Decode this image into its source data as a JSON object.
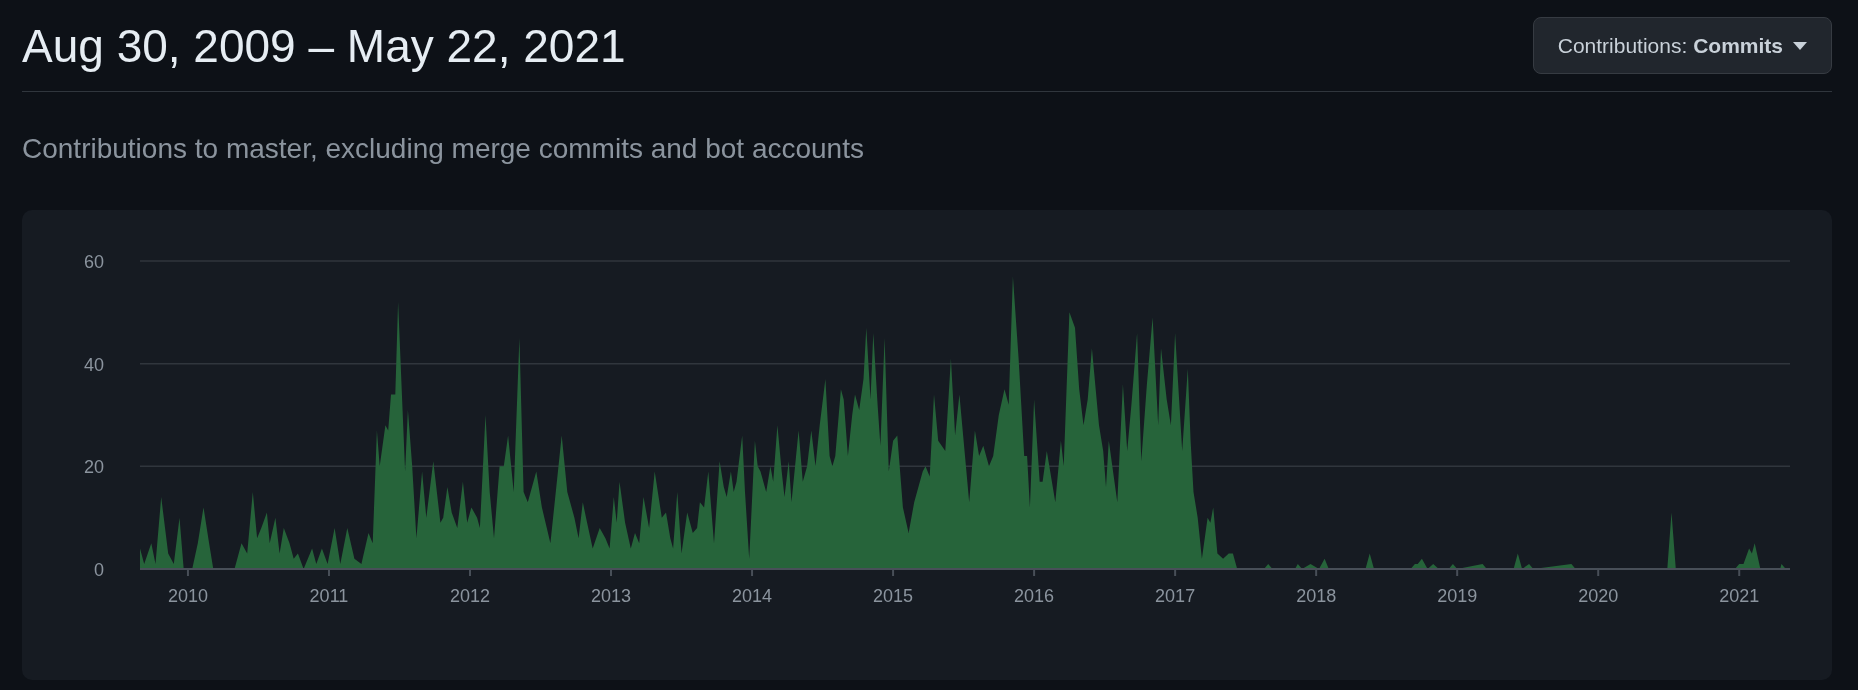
{
  "header": {
    "title": "Aug 30, 2009 – May 22, 2021",
    "menu_button": {
      "label": "Contributions: **Commits**"
    }
  },
  "subtitle": "Contributions to master, excluding merge commits and bot accounts",
  "chart": {
    "chart_data": {
      "type": "area",
      "xlim": [
        2009.66,
        2021.36
      ],
      "ylim": [
        0,
        60
      ],
      "yticks": [
        0,
        20,
        40,
        60
      ],
      "xticks": [
        2010,
        2011,
        2012,
        2013,
        2014,
        2015,
        2016,
        2017,
        2018,
        2019,
        2020,
        2021
      ],
      "x": [
        2009.66,
        2009.69,
        2009.74,
        2009.77,
        2009.81,
        2009.86,
        2009.9,
        2009.94,
        2009.97,
        2010.03,
        2010.07,
        2010.11,
        2010.15,
        2010.18,
        2010.33,
        2010.38,
        2010.42,
        2010.46,
        2010.49,
        2010.52,
        2010.56,
        2010.58,
        2010.62,
        2010.65,
        2010.68,
        2010.72,
        2010.75,
        2010.78,
        2010.82,
        2010.88,
        2010.91,
        2010.95,
        2010.99,
        2011.04,
        2011.08,
        2011.13,
        2011.18,
        2011.23,
        2011.28,
        2011.31,
        2011.34,
        2011.36,
        2011.4,
        2011.42,
        2011.44,
        2011.47,
        2011.49,
        2011.54,
        2011.56,
        2011.59,
        2011.62,
        2011.66,
        2011.69,
        2011.74,
        2011.79,
        2011.81,
        2011.84,
        2011.87,
        2011.91,
        2011.95,
        2011.98,
        2012.01,
        2012.05,
        2012.07,
        2012.11,
        2012.14,
        2012.17,
        2012.21,
        2012.24,
        2012.27,
        2012.31,
        2012.35,
        2012.38,
        2012.41,
        2012.47,
        2012.51,
        2012.57,
        2012.65,
        2012.69,
        2012.74,
        2012.77,
        2012.8,
        2012.83,
        2012.87,
        2012.92,
        2012.96,
        2012.99,
        2013.02,
        2013.04,
        2013.06,
        2013.1,
        2013.14,
        2013.17,
        2013.2,
        2013.23,
        2013.27,
        2013.31,
        2013.36,
        2013.39,
        2013.42,
        2013.44,
        2013.47,
        2013.5,
        2013.54,
        2013.58,
        2013.61,
        2013.63,
        2013.66,
        2013.69,
        2013.73,
        2013.77,
        2013.8,
        2013.82,
        2013.85,
        2013.87,
        2013.89,
        2013.93,
        2013.95,
        2013.98,
        2014.02,
        2014.04,
        2014.06,
        2014.1,
        2014.13,
        2014.15,
        2014.18,
        2014.21,
        2014.23,
        2014.26,
        2014.28,
        2014.33,
        2014.36,
        2014.39,
        2014.42,
        2014.45,
        2014.48,
        2014.52,
        2014.55,
        2014.57,
        2014.59,
        2014.63,
        2014.65,
        2014.68,
        2014.71,
        2014.73,
        2014.76,
        2014.79,
        2014.81,
        2014.84,
        2014.86,
        2014.89,
        2014.91,
        2014.94,
        2014.97,
        2015.0,
        2015.03,
        2015.07,
        2015.11,
        2015.15,
        2015.21,
        2015.23,
        2015.26,
        2015.29,
        2015.32,
        2015.37,
        2015.41,
        2015.44,
        2015.47,
        2015.51,
        2015.54,
        2015.58,
        2015.61,
        2015.64,
        2015.68,
        2015.71,
        2015.75,
        2015.79,
        2015.82,
        2015.85,
        2015.89,
        2015.93,
        2015.95,
        2015.97,
        2016.0,
        2016.04,
        2016.06,
        2016.09,
        2016.15,
        2016.19,
        2016.21,
        2016.25,
        2016.29,
        2016.32,
        2016.35,
        2016.38,
        2016.41,
        2016.46,
        2016.49,
        2016.51,
        2016.53,
        2016.59,
        2016.63,
        2016.66,
        2016.69,
        2016.73,
        2016.76,
        2016.8,
        2016.84,
        2016.88,
        2016.9,
        2016.94,
        2016.97,
        2017.0,
        2017.05,
        2017.09,
        2017.11,
        2017.13,
        2017.16,
        2017.19,
        2017.23,
        2017.25,
        2017.27,
        2017.3,
        2017.34,
        2017.38,
        2017.41,
        2017.44,
        2017.63,
        2017.66,
        2017.69,
        2017.85,
        2017.87,
        2017.9,
        2017.96,
        2018.02,
        2018.06,
        2018.09,
        2018.35,
        2018.38,
        2018.41,
        2018.67,
        2018.7,
        2018.72,
        2018.75,
        2018.79,
        2018.83,
        2018.87,
        2018.94,
        2018.97,
        2019.0,
        2019.18,
        2019.21,
        2019.4,
        2019.43,
        2019.46,
        2019.51,
        2019.54,
        2019.81,
        2019.84,
        2020.49,
        2020.52,
        2020.55,
        2020.97,
        2021.0,
        2021.03,
        2021.07,
        2021.09,
        2021.11,
        2021.15,
        2021.29,
        2021.3,
        2021.33,
        2021.36
      ],
      "series": [
        {
          "color": "#26643a",
          "values": [
            4,
            1,
            5,
            1,
            14,
            3,
            1,
            10,
            0,
            0,
            5,
            12,
            5,
            0,
            0,
            5,
            3,
            15,
            6,
            8,
            11,
            5,
            10,
            3,
            8,
            5,
            2,
            3,
            0,
            4,
            1,
            4,
            1,
            8,
            1,
            8,
            2,
            1,
            7,
            5,
            27,
            20,
            28,
            27,
            34,
            34,
            52,
            19,
            31,
            20,
            6,
            19,
            10,
            21,
            9,
            10,
            16,
            11,
            8,
            17,
            9,
            12,
            10,
            8,
            30,
            15,
            6,
            20,
            20,
            26,
            15,
            45,
            15,
            13,
            19,
            12,
            5,
            26,
            15,
            10,
            6,
            13,
            9,
            4,
            8,
            6,
            4,
            14,
            9,
            17,
            9,
            4,
            7,
            5,
            14,
            8,
            19,
            10,
            11,
            6,
            4,
            15,
            3,
            11,
            7,
            8,
            13,
            12,
            19,
            5,
            21,
            16,
            14,
            19,
            15,
            17,
            26,
            15,
            2,
            25,
            20,
            19,
            15,
            20,
            17,
            28,
            19,
            14,
            21,
            13,
            27,
            17,
            20,
            27,
            20,
            28,
            37,
            22,
            20,
            22,
            35,
            33,
            22,
            30,
            34,
            31,
            37,
            47,
            33,
            46,
            32,
            24,
            45,
            19,
            25,
            26,
            12,
            7,
            13,
            19,
            20,
            18,
            34,
            25,
            23,
            41,
            26,
            34,
            22,
            13,
            27,
            22,
            24,
            20,
            22,
            30,
            35,
            32,
            57,
            41,
            22,
            22,
            12,
            33,
            17,
            17,
            23,
            13,
            25,
            20,
            50,
            47,
            35,
            28,
            33,
            43,
            28,
            23,
            16,
            25,
            13,
            36,
            23,
            32,
            46,
            21,
            36,
            49,
            28,
            43,
            33,
            28,
            46,
            23,
            39,
            25,
            15,
            10,
            2,
            10,
            9,
            12,
            3,
            2,
            3,
            3,
            0,
            0,
            1,
            0,
            0,
            1,
            0,
            1,
            0,
            2,
            0,
            0,
            3,
            0,
            0,
            1,
            1,
            2,
            0,
            1,
            0,
            0,
            1,
            0,
            1,
            0,
            0,
            3,
            0,
            1,
            0,
            1,
            0,
            0,
            11,
            0,
            0,
            1,
            1,
            4,
            3,
            5,
            0,
            0,
            1,
            0,
            0
          ]
        }
      ]
    }
  }
}
